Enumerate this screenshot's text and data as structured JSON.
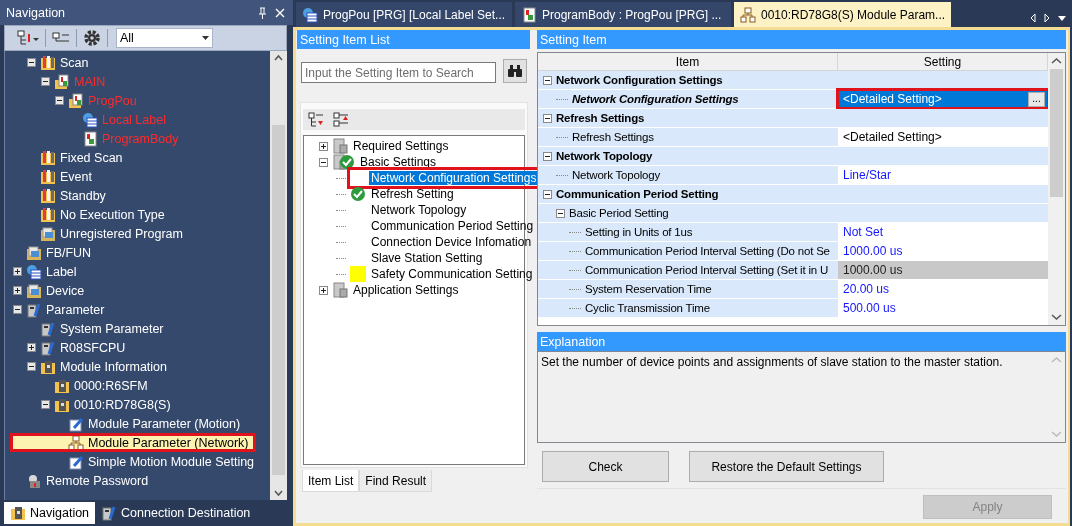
{
  "nav": {
    "title": "Navigation",
    "toolbar": {
      "filter": "All"
    },
    "tree": {
      "continued": [
        {
          "label": "Scan",
          "kind": "folder",
          "expanded": true,
          "unconverted": false,
          "selected": false,
          "children": [
            {
              "label": "MAIN",
              "kind": "program",
              "expanded": true,
              "unconverted": true,
              "selected": false,
              "children": [
                {
                  "label": "ProgPou",
                  "kind": "program",
                  "expanded": true,
                  "unconverted": true,
                  "selected": false,
                  "children": [
                    {
                      "label": "Local Label",
                      "kind": "table",
                      "unconverted": true,
                      "selected": false
                    },
                    {
                      "label": "ProgramBody",
                      "kind": "document",
                      "unconverted": true,
                      "selected": false
                    }
                  ]
                }
              ]
            }
          ]
        },
        {
          "label": "Fixed Scan",
          "kind": "folder",
          "unconverted": false,
          "selected": false
        },
        {
          "label": "Event",
          "kind": "folder",
          "unconverted": false,
          "selected": false
        },
        {
          "label": "Standby",
          "kind": "folder",
          "unconverted": false,
          "selected": false
        },
        {
          "label": "No Execution Type",
          "kind": "folder",
          "unconverted": false,
          "selected": false
        },
        {
          "label": "Unregistered Program",
          "kind": "archive",
          "unconverted": false,
          "selected": false
        }
      ],
      "items": [
        {
          "label": "FB/FUN",
          "kind": "archive",
          "unconverted": false,
          "selected": false
        },
        {
          "label": "Label",
          "kind": "table",
          "expanded": false,
          "unconverted": false,
          "selected": false
        },
        {
          "label": "Device",
          "kind": "archive",
          "expanded": false,
          "unconverted": false,
          "selected": false
        },
        {
          "label": "Parameter",
          "kind": "wrench",
          "expanded": true,
          "unconverted": false,
          "selected": false,
          "children": [
            {
              "label": "System Parameter",
              "kind": "wrench",
              "unconverted": false,
              "selected": false
            },
            {
              "label": "R08SFCPU",
              "kind": "wrench",
              "expanded": false,
              "unconverted": false,
              "selected": false
            },
            {
              "label": "Module Information",
              "kind": "module",
              "expanded": true,
              "unconverted": false,
              "selected": false,
              "children": [
                {
                  "label": "0000:R6SFM",
                  "kind": "module",
                  "unconverted": false,
                  "selected": false
                },
                {
                  "label": "0010:RD78G8(S)",
                  "kind": "module",
                  "expanded": true,
                  "unconverted": false,
                  "selected": false,
                  "children": [
                    {
                      "label": "Module Parameter (Motion)",
                      "kind": "pencil",
                      "unconverted": false,
                      "selected": false
                    },
                    {
                      "label": "Module Parameter (Network)",
                      "kind": "network",
                      "unconverted": false,
                      "selected": true
                    },
                    {
                      "label": "Simple Motion Module Setting",
                      "kind": "pencil",
                      "unconverted": false,
                      "selected": false
                    }
                  ]
                }
              ]
            }
          ]
        },
        {
          "label": "Remote Password",
          "kind": "lock",
          "unconverted": false,
          "selected": false
        }
      ]
    },
    "tabs": [
      {
        "label": "Navigation",
        "selected": true
      },
      {
        "label": "Connection Destination",
        "selected": false
      }
    ]
  },
  "doc_tabs": [
    {
      "label": "ProgPou [PRG] [Local Label Set...",
      "kind": "table",
      "selected": false
    },
    {
      "label": "ProgramBody : ProgPou [PRG] ...",
      "kind": "document",
      "selected": false
    },
    {
      "label": "0010:RD78G8(S) Module Param...",
      "kind": "network",
      "selected": true
    }
  ],
  "item_list": {
    "title": "Setting Item List",
    "search": {
      "placeholder": "Input the Setting Item to Search"
    },
    "tree": [
      {
        "label": "Required Settings",
        "expanded": false,
        "done": false,
        "pending": false,
        "selected": false
      },
      {
        "label": "Basic Settings",
        "expanded": true,
        "done": true,
        "pending": false,
        "selected": false,
        "children": [
          {
            "label": "Network Configuration Settings",
            "done": false,
            "pending": false,
            "selected": true
          },
          {
            "label": "Refresh Setting",
            "done": true,
            "pending": false,
            "selected": false
          },
          {
            "label": "Network Topology",
            "done": false,
            "pending": false,
            "selected": false
          },
          {
            "label": "Communication Period Setting",
            "done": false,
            "pending": false,
            "selected": false
          },
          {
            "label": "Connection Device Infomation",
            "done": false,
            "pending": false,
            "selected": false
          },
          {
            "label": "Slave Station Setting",
            "done": false,
            "pending": false,
            "selected": false
          },
          {
            "label": "Safety Communication Setting",
            "done": false,
            "pending": true,
            "selected": false
          }
        ]
      },
      {
        "label": "Application Settings",
        "expanded": false,
        "done": false,
        "pending": false,
        "selected": false
      }
    ],
    "tabs": [
      {
        "label": "Item List",
        "selected": true
      },
      {
        "label": "Find Result",
        "selected": false
      }
    ]
  },
  "setting": {
    "title": "Setting Item",
    "columns": [
      "Item",
      "Setting"
    ],
    "rows": [
      {
        "kind": "group",
        "label": "Network Configuration Settings",
        "expanded": true,
        "children": [
          {
            "kind": "item",
            "label": "Network Configuration Settings",
            "value": "<Detailed Setting>",
            "action": "...",
            "emphasized": true,
            "changed": false,
            "disabled": false,
            "selected": true
          }
        ]
      },
      {
        "kind": "group",
        "label": "Refresh Settings",
        "expanded": true,
        "children": [
          {
            "kind": "item",
            "label": "Refresh Settings",
            "value": "<Detailed Setting>",
            "emphasized": false,
            "changed": false,
            "disabled": false,
            "selected": false
          }
        ]
      },
      {
        "kind": "group",
        "label": "Network Topology",
        "expanded": true,
        "children": [
          {
            "kind": "item",
            "label": "Network Topology",
            "value": "Line/Star",
            "emphasized": false,
            "changed": true,
            "disabled": false,
            "selected": false
          }
        ]
      },
      {
        "kind": "group",
        "label": "Communication Period Setting",
        "expanded": true,
        "children": [
          {
            "kind": "group",
            "label": "Basic Period Setting",
            "expanded": true,
            "children": [
              {
                "kind": "item",
                "label": "Setting in Units of 1us",
                "value": "Not Set",
                "emphasized": false,
                "changed": true,
                "disabled": false,
                "selected": false
              },
              {
                "kind": "item",
                "label": "Communication Period Interval Setting (Do not Se",
                "value": "1000.00 us",
                "emphasized": false,
                "changed": true,
                "disabled": false,
                "selected": false
              },
              {
                "kind": "item",
                "label": "Communication Period Interval Setting (Set it in U",
                "value": "1000.00 us",
                "emphasized": false,
                "changed": false,
                "disabled": true,
                "selected": false
              },
              {
                "kind": "item",
                "label": "System Reservation Time",
                "value": "20.00 us",
                "emphasized": false,
                "changed": true,
                "disabled": false,
                "selected": false
              },
              {
                "kind": "item",
                "label": "Cyclic Transmission Time",
                "value": "500.00 us",
                "emphasized": false,
                "changed": true,
                "disabled": false,
                "selected": false
              }
            ]
          }
        ]
      }
    ],
    "explanation": {
      "title": "Explanation",
      "text": "Set the number of device points and assignments of slave station to the master station."
    },
    "buttons": [
      {
        "label": "Check",
        "disabled": false
      },
      {
        "label": "Restore the Default Settings",
        "disabled": false
      }
    ],
    "apply": {
      "label": "Apply",
      "disabled": true
    }
  }
}
